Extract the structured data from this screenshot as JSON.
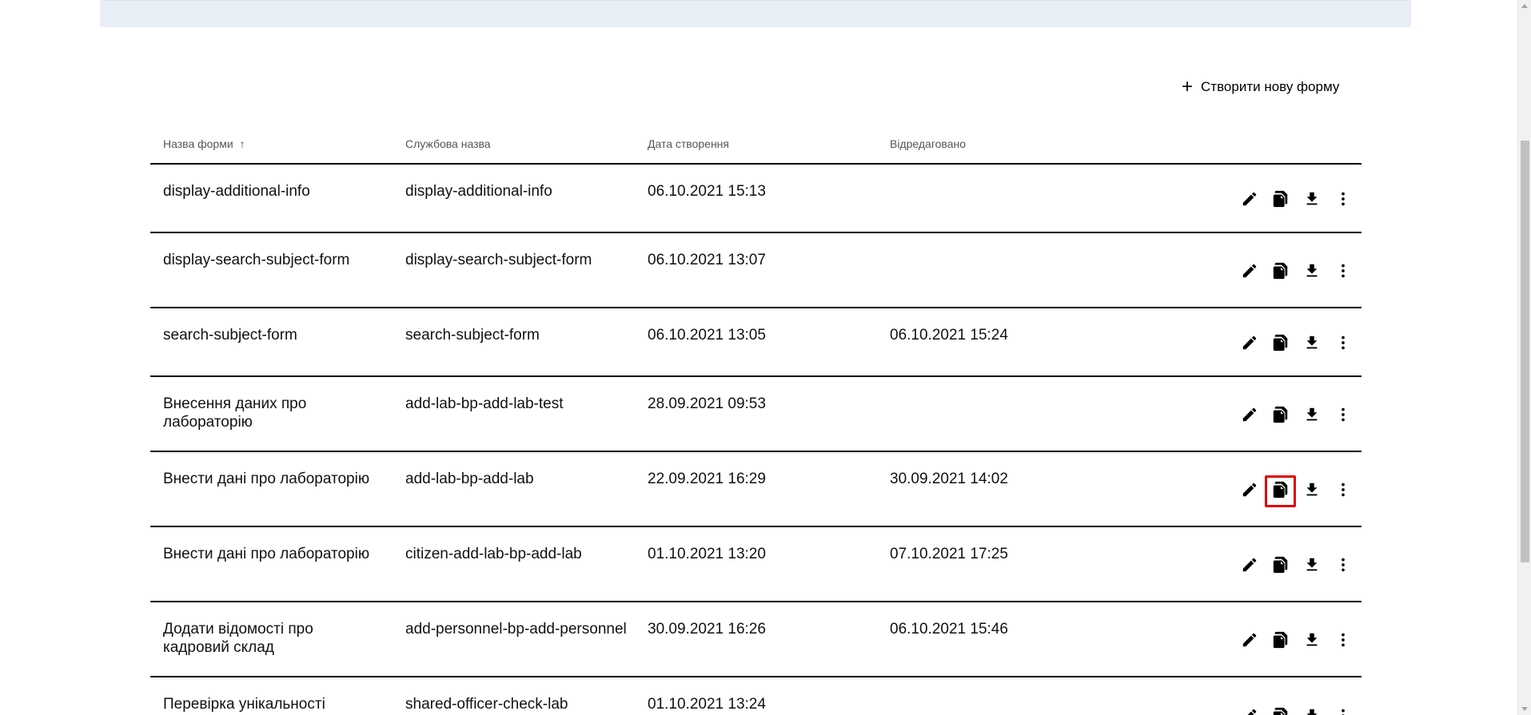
{
  "create_button": {
    "icon": "plus-icon",
    "label": "Створити нову форму"
  },
  "columns": {
    "name": "Назва форми",
    "name_sort_icon": "arrow-up-icon",
    "service_name": "Службова назва",
    "created": "Дата створення",
    "edited": "Відредаговано"
  },
  "rows": [
    {
      "name": "display-additional-info",
      "service_name": "display-additional-info",
      "created": "06.10.2021 15:13",
      "edited": ""
    },
    {
      "name": "display-search-subject-form",
      "service_name": "display-search-subject-form",
      "created": "06.10.2021 13:07",
      "edited": ""
    },
    {
      "name": "search-subject-form",
      "service_name": "search-subject-form",
      "created": "06.10.2021 13:05",
      "edited": "06.10.2021 15:24"
    },
    {
      "name": "Внесення даних про лабораторію",
      "service_name": "add-lab-bp-add-lab-test",
      "created": "28.09.2021 09:53",
      "edited": ""
    },
    {
      "name": "Внести дані про лабораторію",
      "service_name": "add-lab-bp-add-lab",
      "created": "22.09.2021 16:29",
      "edited": "30.09.2021 14:02"
    },
    {
      "name": "Внести дані про лабораторію",
      "service_name": "citizen-add-lab-bp-add-lab",
      "created": "01.10.2021 13:20",
      "edited": "07.10.2021 17:25"
    },
    {
      "name": "Додати відомості про кадровий склад",
      "service_name": "add-personnel-bp-add-personnel",
      "created": "30.09.2021 16:26",
      "edited": "06.10.2021 15:46"
    },
    {
      "name": "Перевірка унікальності",
      "service_name": "shared-officer-check-lab",
      "created": "01.10.2021 13:24",
      "edited": ""
    }
  ],
  "row_actions": [
    "edit-icon",
    "copy-icon",
    "download-icon",
    "more-vertical-icon"
  ],
  "highlight_color": "#e00000"
}
